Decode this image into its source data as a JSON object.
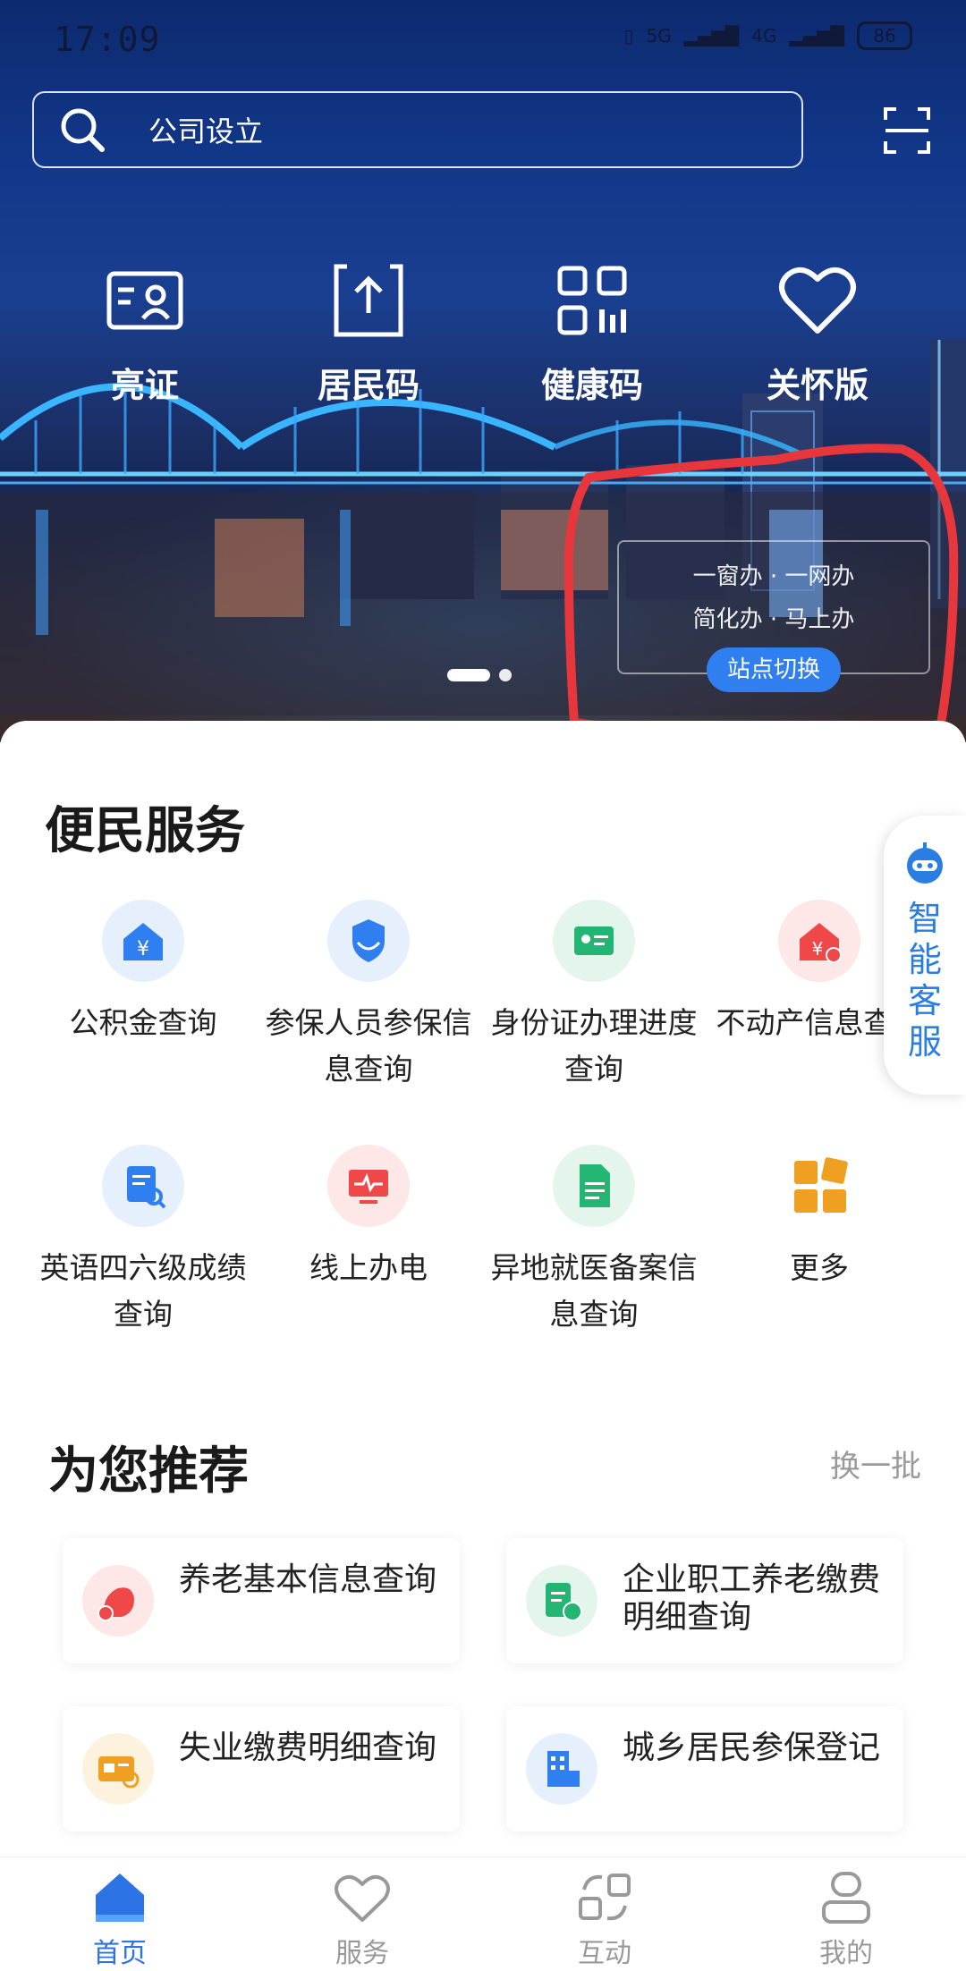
{
  "status_bar": {
    "time": "17:09",
    "network_1": "5G",
    "network_2": "4G",
    "battery": "86"
  },
  "search": {
    "placeholder": "公司设立"
  },
  "quick_actions": [
    {
      "label": "亮证",
      "icon": "id-card-icon"
    },
    {
      "label": "居民码",
      "icon": "upload-code-icon"
    },
    {
      "label": "健康码",
      "icon": "qr-code-icon"
    },
    {
      "label": "关怀版",
      "icon": "heart-icon"
    }
  ],
  "banner": {
    "line1": "一窗办 · 一网办",
    "line2": "简化办 · 马上办",
    "switch_site_label": "站点切换"
  },
  "convenience": {
    "title": "便民服务",
    "items": [
      {
        "label": "公积金查询",
        "icon": "house-fund-icon",
        "color": "#2f7ff0"
      },
      {
        "label": "参保人员参保信息查询",
        "icon": "insurance-shield-icon",
        "color": "#2f7ff0"
      },
      {
        "label": "身份证办理进度查询",
        "icon": "id-progress-icon",
        "color": "#22b573"
      },
      {
        "label": "不动产信息查询",
        "icon": "real-estate-icon",
        "color": "#f04848"
      },
      {
        "label": "英语四六级成绩查询",
        "icon": "exam-score-icon",
        "color": "#2f7ff0"
      },
      {
        "label": "线上办电",
        "icon": "electricity-icon",
        "color": "#f04848"
      },
      {
        "label": "异地就医备案信息查询",
        "icon": "medical-document-icon",
        "color": "#22b573"
      },
      {
        "label": "更多",
        "icon": "more-grid-icon",
        "color": "#f0a020"
      }
    ]
  },
  "ai_service": {
    "label": "智能客服"
  },
  "recommend": {
    "title": "为您推荐",
    "refresh_label": "换一批",
    "items": [
      {
        "label": "养老基本信息查询",
        "icon": "pension-icon",
        "color": "#f04848"
      },
      {
        "label": "企业职工养老缴费明细查询",
        "icon": "payment-detail-icon",
        "color": "#22b573"
      },
      {
        "label": "失业缴费明细查询",
        "icon": "unemployment-card-icon",
        "color": "#f0a020"
      },
      {
        "label": "城乡居民参保登记",
        "icon": "building-icon",
        "color": "#2f7ff0"
      }
    ]
  },
  "bottom_nav": [
    {
      "label": "首页",
      "active": true
    },
    {
      "label": "服务",
      "active": false
    },
    {
      "label": "互动",
      "active": false
    },
    {
      "label": "我的",
      "active": false
    }
  ],
  "colors": {
    "accent": "#2c73e6",
    "annotation": "#e8363d"
  }
}
